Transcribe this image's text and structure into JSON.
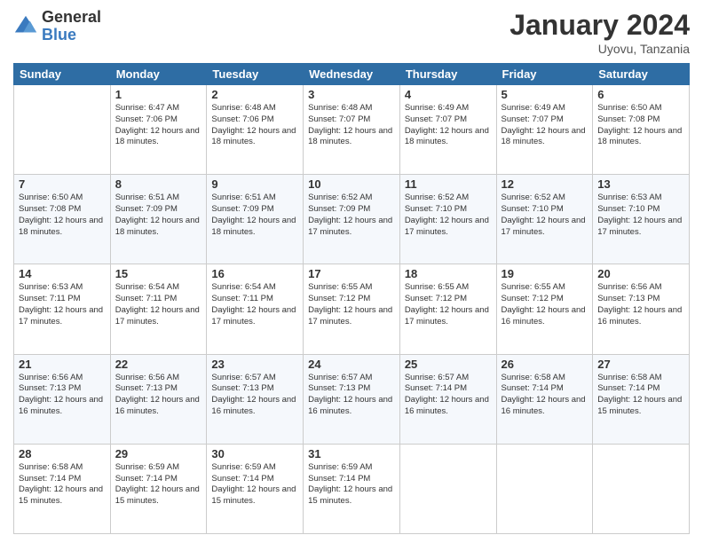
{
  "logo": {
    "general": "General",
    "blue": "Blue"
  },
  "header": {
    "month": "January 2024",
    "location": "Uyovu, Tanzania"
  },
  "weekdays": [
    "Sunday",
    "Monday",
    "Tuesday",
    "Wednesday",
    "Thursday",
    "Friday",
    "Saturday"
  ],
  "weeks": [
    [
      {
        "day": "",
        "sunrise": "",
        "sunset": "",
        "daylight": ""
      },
      {
        "day": "1",
        "sunrise": "Sunrise: 6:47 AM",
        "sunset": "Sunset: 7:06 PM",
        "daylight": "Daylight: 12 hours and 18 minutes."
      },
      {
        "day": "2",
        "sunrise": "Sunrise: 6:48 AM",
        "sunset": "Sunset: 7:06 PM",
        "daylight": "Daylight: 12 hours and 18 minutes."
      },
      {
        "day": "3",
        "sunrise": "Sunrise: 6:48 AM",
        "sunset": "Sunset: 7:07 PM",
        "daylight": "Daylight: 12 hours and 18 minutes."
      },
      {
        "day": "4",
        "sunrise": "Sunrise: 6:49 AM",
        "sunset": "Sunset: 7:07 PM",
        "daylight": "Daylight: 12 hours and 18 minutes."
      },
      {
        "day": "5",
        "sunrise": "Sunrise: 6:49 AM",
        "sunset": "Sunset: 7:07 PM",
        "daylight": "Daylight: 12 hours and 18 minutes."
      },
      {
        "day": "6",
        "sunrise": "Sunrise: 6:50 AM",
        "sunset": "Sunset: 7:08 PM",
        "daylight": "Daylight: 12 hours and 18 minutes."
      }
    ],
    [
      {
        "day": "7",
        "sunrise": "Sunrise: 6:50 AM",
        "sunset": "Sunset: 7:08 PM",
        "daylight": "Daylight: 12 hours and 18 minutes."
      },
      {
        "day": "8",
        "sunrise": "Sunrise: 6:51 AM",
        "sunset": "Sunset: 7:09 PM",
        "daylight": "Daylight: 12 hours and 18 minutes."
      },
      {
        "day": "9",
        "sunrise": "Sunrise: 6:51 AM",
        "sunset": "Sunset: 7:09 PM",
        "daylight": "Daylight: 12 hours and 18 minutes."
      },
      {
        "day": "10",
        "sunrise": "Sunrise: 6:52 AM",
        "sunset": "Sunset: 7:09 PM",
        "daylight": "Daylight: 12 hours and 17 minutes."
      },
      {
        "day": "11",
        "sunrise": "Sunrise: 6:52 AM",
        "sunset": "Sunset: 7:10 PM",
        "daylight": "Daylight: 12 hours and 17 minutes."
      },
      {
        "day": "12",
        "sunrise": "Sunrise: 6:52 AM",
        "sunset": "Sunset: 7:10 PM",
        "daylight": "Daylight: 12 hours and 17 minutes."
      },
      {
        "day": "13",
        "sunrise": "Sunrise: 6:53 AM",
        "sunset": "Sunset: 7:10 PM",
        "daylight": "Daylight: 12 hours and 17 minutes."
      }
    ],
    [
      {
        "day": "14",
        "sunrise": "Sunrise: 6:53 AM",
        "sunset": "Sunset: 7:11 PM",
        "daylight": "Daylight: 12 hours and 17 minutes."
      },
      {
        "day": "15",
        "sunrise": "Sunrise: 6:54 AM",
        "sunset": "Sunset: 7:11 PM",
        "daylight": "Daylight: 12 hours and 17 minutes."
      },
      {
        "day": "16",
        "sunrise": "Sunrise: 6:54 AM",
        "sunset": "Sunset: 7:11 PM",
        "daylight": "Daylight: 12 hours and 17 minutes."
      },
      {
        "day": "17",
        "sunrise": "Sunrise: 6:55 AM",
        "sunset": "Sunset: 7:12 PM",
        "daylight": "Daylight: 12 hours and 17 minutes."
      },
      {
        "day": "18",
        "sunrise": "Sunrise: 6:55 AM",
        "sunset": "Sunset: 7:12 PM",
        "daylight": "Daylight: 12 hours and 17 minutes."
      },
      {
        "day": "19",
        "sunrise": "Sunrise: 6:55 AM",
        "sunset": "Sunset: 7:12 PM",
        "daylight": "Daylight: 12 hours and 16 minutes."
      },
      {
        "day": "20",
        "sunrise": "Sunrise: 6:56 AM",
        "sunset": "Sunset: 7:13 PM",
        "daylight": "Daylight: 12 hours and 16 minutes."
      }
    ],
    [
      {
        "day": "21",
        "sunrise": "Sunrise: 6:56 AM",
        "sunset": "Sunset: 7:13 PM",
        "daylight": "Daylight: 12 hours and 16 minutes."
      },
      {
        "day": "22",
        "sunrise": "Sunrise: 6:56 AM",
        "sunset": "Sunset: 7:13 PM",
        "daylight": "Daylight: 12 hours and 16 minutes."
      },
      {
        "day": "23",
        "sunrise": "Sunrise: 6:57 AM",
        "sunset": "Sunset: 7:13 PM",
        "daylight": "Daylight: 12 hours and 16 minutes."
      },
      {
        "day": "24",
        "sunrise": "Sunrise: 6:57 AM",
        "sunset": "Sunset: 7:13 PM",
        "daylight": "Daylight: 12 hours and 16 minutes."
      },
      {
        "day": "25",
        "sunrise": "Sunrise: 6:57 AM",
        "sunset": "Sunset: 7:14 PM",
        "daylight": "Daylight: 12 hours and 16 minutes."
      },
      {
        "day": "26",
        "sunrise": "Sunrise: 6:58 AM",
        "sunset": "Sunset: 7:14 PM",
        "daylight": "Daylight: 12 hours and 16 minutes."
      },
      {
        "day": "27",
        "sunrise": "Sunrise: 6:58 AM",
        "sunset": "Sunset: 7:14 PM",
        "daylight": "Daylight: 12 hours and 15 minutes."
      }
    ],
    [
      {
        "day": "28",
        "sunrise": "Sunrise: 6:58 AM",
        "sunset": "Sunset: 7:14 PM",
        "daylight": "Daylight: 12 hours and 15 minutes."
      },
      {
        "day": "29",
        "sunrise": "Sunrise: 6:59 AM",
        "sunset": "Sunset: 7:14 PM",
        "daylight": "Daylight: 12 hours and 15 minutes."
      },
      {
        "day": "30",
        "sunrise": "Sunrise: 6:59 AM",
        "sunset": "Sunset: 7:14 PM",
        "daylight": "Daylight: 12 hours and 15 minutes."
      },
      {
        "day": "31",
        "sunrise": "Sunrise: 6:59 AM",
        "sunset": "Sunset: 7:14 PM",
        "daylight": "Daylight: 12 hours and 15 minutes."
      },
      {
        "day": "",
        "sunrise": "",
        "sunset": "",
        "daylight": ""
      },
      {
        "day": "",
        "sunrise": "",
        "sunset": "",
        "daylight": ""
      },
      {
        "day": "",
        "sunrise": "",
        "sunset": "",
        "daylight": ""
      }
    ]
  ]
}
